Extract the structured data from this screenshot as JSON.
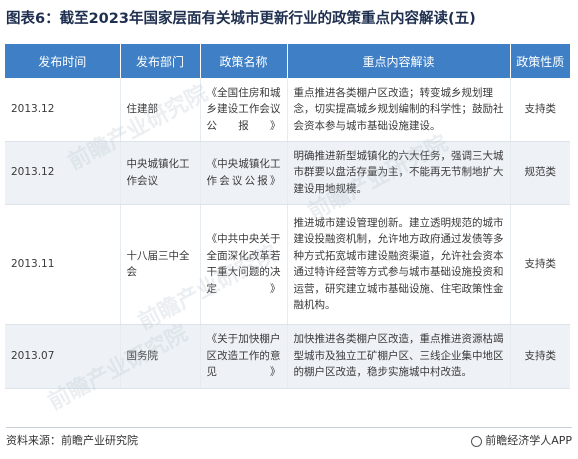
{
  "title": "图表6：截至2023年国家层面有关城市更新行业的政策重点内容解读(五)",
  "table": {
    "headers": [
      "发布时间",
      "发布部门",
      "政策名称",
      "重点内容解读",
      "政策性质"
    ],
    "rows": [
      {
        "date": "2013.12",
        "dept": "住建部",
        "name": "《全国住房和城乡建设工作会议公报》",
        "content": "重点推进各类棚户区改造；转变城乡规划理念，切实提高城乡规划编制的科学性；鼓励社会资本参与城市基础设施建设。",
        "type": "支持类"
      },
      {
        "date": "2013.12",
        "dept": "中央城镇化工作会议",
        "name": "《中央城镇化工作会议公报》",
        "content": "明确推进新型城镇化的六大任务，强调三大城市群要以盘活存量为主，不能再无节制地扩大建设用地规模。",
        "type": "规范类"
      },
      {
        "date": "2013.11",
        "dept": "十八届三中全会",
        "name": "《中共中央关于全面深化改革若干重大问题的决定》",
        "content": "推进城市建设管理创新。建立透明规范的城市建设投融资机制，允许地方政府通过发债等多种方式拓宽城市建设融资渠道，允许社会资本通过特许经营等方式参与城市基础设施投资和运营，研究建立城市基础设施、住宅政策性金融机构。",
        "type": "支持类"
      },
      {
        "date": "2013.07",
        "dept": "国务院",
        "name": "《关于加快棚户区改造工作的意见》",
        "content": "加快推进各类棚户区改造，重点推进资源枯竭型城市及独立工矿棚户区、三线企业集中地区的棚户区改造，稳步实施城中村改造。",
        "type": "支持类"
      }
    ]
  },
  "footer": {
    "source": "资料来源：前瞻产业研究院",
    "brand": "前瞻经济学人APP",
    "brand_icon": "qianzhan-logo-icon"
  },
  "watermark_text": "前瞻产业研究院"
}
